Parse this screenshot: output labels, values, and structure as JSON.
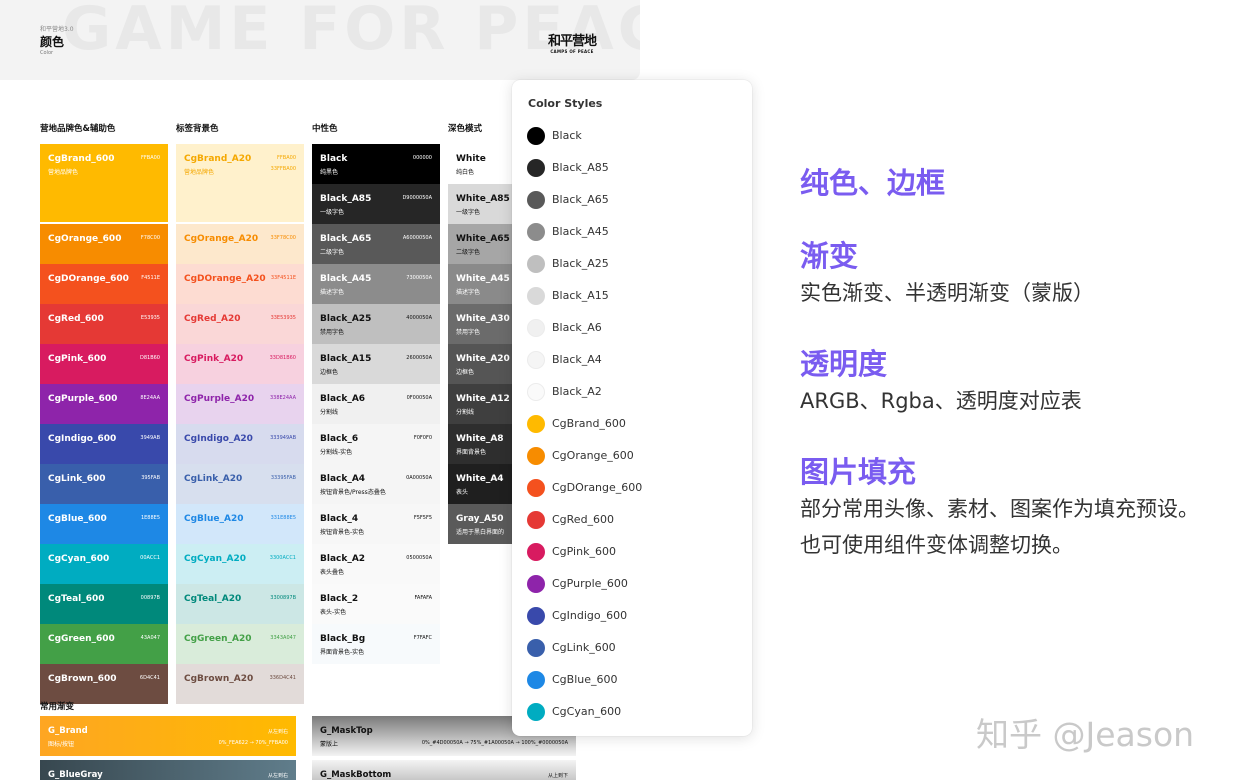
{
  "header": {
    "watermark": "GAME FOR PEACE",
    "small": "和平营地3.0",
    "title": "颜色",
    "subtitle": "Color",
    "logo_cn": "和平营地",
    "logo_en": "CAMPS OF PEACE"
  },
  "columns": [
    {
      "title": "营地品牌色&辅助色",
      "swatches": [
        {
          "name": "CgBrand_600",
          "desc": "营地品牌色",
          "hex": "FFBA00",
          "bg": "#FFBA00",
          "fg": "#ffffff"
        },
        {
          "name": "CgOrange_600",
          "hex": "F78C00",
          "bg": "#F78C00",
          "fg": "#ffffff"
        },
        {
          "name": "CgDOrange_600",
          "hex": "F4511E",
          "bg": "#F4511E",
          "fg": "#ffffff"
        },
        {
          "name": "CgRed_600",
          "hex": "E53935",
          "bg": "#E53935",
          "fg": "#ffffff"
        },
        {
          "name": "CgPink_600",
          "hex": "D81B60",
          "bg": "#D81B60",
          "fg": "#ffffff"
        },
        {
          "name": "CgPurple_600",
          "hex": "8E24AA",
          "bg": "#8E24AA",
          "fg": "#ffffff"
        },
        {
          "name": "CgIndigo_600",
          "hex": "3949AB",
          "bg": "#3949AB",
          "fg": "#ffffff"
        },
        {
          "name": "CgLink_600",
          "hex": "395FAB",
          "bg": "#395FAB",
          "fg": "#ffffff"
        },
        {
          "name": "CgBlue_600",
          "hex": "1E88E5",
          "bg": "#1E88E5",
          "fg": "#ffffff"
        },
        {
          "name": "CgCyan_600",
          "hex": "00ACC1",
          "bg": "#00ACC1",
          "fg": "#ffffff"
        },
        {
          "name": "CgTeal_600",
          "hex": "00897B",
          "bg": "#00897B",
          "fg": "#ffffff"
        },
        {
          "name": "CgGreen_600",
          "hex": "43A047",
          "bg": "#43A047",
          "fg": "#ffffff"
        },
        {
          "name": "CgBrown_600",
          "hex": "6D4C41",
          "bg": "#6D4C41",
          "fg": "#ffffff"
        }
      ]
    },
    {
      "title": "标签背景色",
      "swatches": [
        {
          "name": "CgBrand_A20",
          "desc": "营地品牌色",
          "hex": "FFBA00",
          "hex2": "33FFBA00",
          "bg": "#FFF1CC",
          "fg": "#F5A800"
        },
        {
          "name": "CgOrange_A20",
          "hex": "33F78C00",
          "bg": "#FDE8CC",
          "fg": "#F78C00"
        },
        {
          "name": "CgDOrange_A20",
          "hex": "33F4511E",
          "bg": "#FDDCD2",
          "fg": "#F4511E"
        },
        {
          "name": "CgRed_A20",
          "hex": "33E53935",
          "bg": "#FAD7D7",
          "fg": "#E53935"
        },
        {
          "name": "CgPink_A20",
          "hex": "33D81B60",
          "bg": "#F7D1DF",
          "fg": "#D81B60"
        },
        {
          "name": "CgPurple_A20",
          "hex": "338E24AA",
          "bg": "#E8D3EE",
          "fg": "#8E24AA"
        },
        {
          "name": "CgIndigo_A20",
          "hex": "333949AB",
          "bg": "#D7DBEE",
          "fg": "#3949AB"
        },
        {
          "name": "CgLink_A20",
          "hex": "33395FAB",
          "bg": "#D7DFEE",
          "fg": "#395FAB"
        },
        {
          "name": "CgBlue_A20",
          "hex": "331E88E5",
          "bg": "#D2E7FA",
          "fg": "#1E88E5"
        },
        {
          "name": "CgCyan_A20",
          "hex": "3300ACC1",
          "bg": "#CCEEF3",
          "fg": "#00ACC1"
        },
        {
          "name": "CgTeal_A20",
          "hex": "3300897B",
          "bg": "#CCE7E5",
          "fg": "#00897B"
        },
        {
          "name": "CgGreen_A20",
          "hex": "3343A047",
          "bg": "#D9ECDA",
          "fg": "#43A047"
        },
        {
          "name": "CgBrown_A20",
          "hex": "336D4C41",
          "bg": "#E2DBD9",
          "fg": "#6D4C41"
        }
      ]
    },
    {
      "title": "中性色",
      "swatches": [
        {
          "name": "Black",
          "desc": "纯黑色",
          "hex": "000000",
          "bg": "#000000",
          "fg": "#ffffff"
        },
        {
          "name": "Black_A85",
          "desc": "一级字色",
          "hex": "D9000050A",
          "bg": "#262626",
          "fg": "#ffffff"
        },
        {
          "name": "Black_A65",
          "desc": "二级字色",
          "hex": "A6000050A",
          "bg": "#595959",
          "fg": "#ffffff"
        },
        {
          "name": "Black_A45",
          "desc": "描述字色",
          "hex": "7300050A",
          "bg": "#8C8C8C",
          "fg": "#ffffff"
        },
        {
          "name": "Black_A25",
          "desc": "禁用字色",
          "hex": "4000050A",
          "bg": "#BFBFBF",
          "fg": "#111111"
        },
        {
          "name": "Black_A15",
          "desc": "边框色",
          "hex": "2600050A",
          "bg": "#D9D9D9",
          "fg": "#111111"
        },
        {
          "name": "Black_A6",
          "desc": "分割线",
          "hex": "0F00050A",
          "bg": "#F0F0F0",
          "fg": "#111111"
        },
        {
          "name": "Black_6",
          "desc": "分割线-实色",
          "hex": "F0F0F0",
          "bg": "#F5F5F5",
          "fg": "#111111"
        },
        {
          "name": "Black_A4",
          "desc": "按钮背景色/Press态叠色",
          "hex": "0A00050A",
          "bg": "#F5F5F5",
          "fg": "#111111"
        },
        {
          "name": "Black_4",
          "desc": "按钮背景色-实色",
          "hex": "F5F5F5",
          "bg": "#F7F7F7",
          "fg": "#111111"
        },
        {
          "name": "Black_A2",
          "desc": "表头叠色",
          "hex": "0500050A",
          "bg": "#F9F9F9",
          "fg": "#111111"
        },
        {
          "name": "Black_2",
          "desc": "表头-实色",
          "hex": "FAFAFA",
          "bg": "#FAFAFA",
          "fg": "#111111"
        },
        {
          "name": "Black_Bg",
          "desc": "界面背景色-实色",
          "hex": "F7FAFC",
          "bg": "#F7FAFC",
          "fg": "#111111"
        }
      ]
    },
    {
      "title": "深色模式",
      "swatches": [
        {
          "name": "White",
          "desc": "纯白色",
          "bg": "#ffffff",
          "fg": "#111111"
        },
        {
          "name": "White_A85",
          "desc": "一级字色",
          "bg": "#D9D9D9",
          "fg": "#111111"
        },
        {
          "name": "White_A65",
          "desc": "二级字色",
          "bg": "#A6A6A6",
          "fg": "#111111"
        },
        {
          "name": "White_A45",
          "desc": "描述字色",
          "bg": "#8A8A8A",
          "fg": "#ffffff"
        },
        {
          "name": "White_A30",
          "desc": "禁用字色",
          "bg": "#6B6B6B",
          "fg": "#ffffff"
        },
        {
          "name": "White_A20",
          "desc": "边框色",
          "bg": "#555555",
          "fg": "#ffffff"
        },
        {
          "name": "White_A12",
          "desc": "分割线",
          "bg": "#3F3F3F",
          "fg": "#ffffff"
        },
        {
          "name": "White_A8",
          "desc": "界面背景色",
          "bg": "#2E2E2E",
          "fg": "#ffffff"
        },
        {
          "name": "White_A4",
          "desc": "表头",
          "bg": "#1F1F1F",
          "fg": "#ffffff"
        },
        {
          "name": "Gray_A50",
          "desc": "适用于黑白界面的",
          "bg": "#5A5A5A",
          "fg": "#ffffff"
        }
      ]
    }
  ],
  "gradients": {
    "title": "常用渐变",
    "items": [
      {
        "name": "G_Brand",
        "desc": "图标/按钮",
        "dir": "从左到右",
        "stops": "0%_FEA622  →  70%_FFBA00",
        "from": "#FEA622",
        "to": "#FFBA00",
        "fg": "#ffffff"
      },
      {
        "name": "G_MaskTop",
        "desc": "蒙版上",
        "dir": "",
        "stops": "0%_#4D00050A  →  75%_#1A00050A  →  100%_#0000050A",
        "from": "#7A7A7A",
        "to": "#F4F4F4",
        "fg": "#111111"
      },
      {
        "name": "G_BlueGray",
        "desc": "",
        "dir": "从左到右",
        "stops": "",
        "from": "#37474F",
        "to": "#607D8B",
        "fg": "#ffffff"
      },
      {
        "name": "G_MaskBottom",
        "desc": "",
        "dir": "从上到下",
        "stops": "",
        "from": "#F4F4F4",
        "to": "#9A9A9A",
        "fg": "#111111"
      }
    ]
  },
  "panel": {
    "title": "Color Styles",
    "items": [
      {
        "label": "Black",
        "color": "#000000"
      },
      {
        "label": "Black_A85",
        "color": "#262626"
      },
      {
        "label": "Black_A65",
        "color": "#595959"
      },
      {
        "label": "Black_A45",
        "color": "#8C8C8C"
      },
      {
        "label": "Black_A25",
        "color": "#BFBFBF"
      },
      {
        "label": "Black_A15",
        "color": "#D9D9D9"
      },
      {
        "label": "Black_A6",
        "color": "#F0F0F0"
      },
      {
        "label": "Black_A4",
        "color": "#F5F5F5"
      },
      {
        "label": "Black_A2",
        "color": "#FAFAFA"
      },
      {
        "label": "CgBrand_600",
        "color": "#FFBA00"
      },
      {
        "label": "CgOrange_600",
        "color": "#F78C00"
      },
      {
        "label": "CgDOrange_600",
        "color": "#F4511E"
      },
      {
        "label": "CgRed_600",
        "color": "#E53935"
      },
      {
        "label": "CgPink_600",
        "color": "#D81B60"
      },
      {
        "label": "CgPurple_600",
        "color": "#8E24AA"
      },
      {
        "label": "CgIndigo_600",
        "color": "#3949AB"
      },
      {
        "label": "CgLink_600",
        "color": "#395FAB"
      },
      {
        "label": "CgBlue_600",
        "color": "#1E88E5"
      },
      {
        "label": "CgCyan_600",
        "color": "#00ACC1"
      }
    ]
  },
  "features": [
    {
      "heading": "纯色、边框",
      "lines": []
    },
    {
      "heading": "渐变",
      "lines": [
        "实色渐变、半透明渐变（蒙版）"
      ]
    },
    {
      "heading": "透明度",
      "lines": [
        "ARGB、Rgba、透明度对应表"
      ]
    },
    {
      "heading": "图片填充",
      "lines": [
        "部分常用头像、素材、图案作为填充预设。",
        "也可使用组件变体调整切换。"
      ]
    }
  ],
  "credit": "知乎 @Jeason",
  "accent": "#7a5cf0"
}
